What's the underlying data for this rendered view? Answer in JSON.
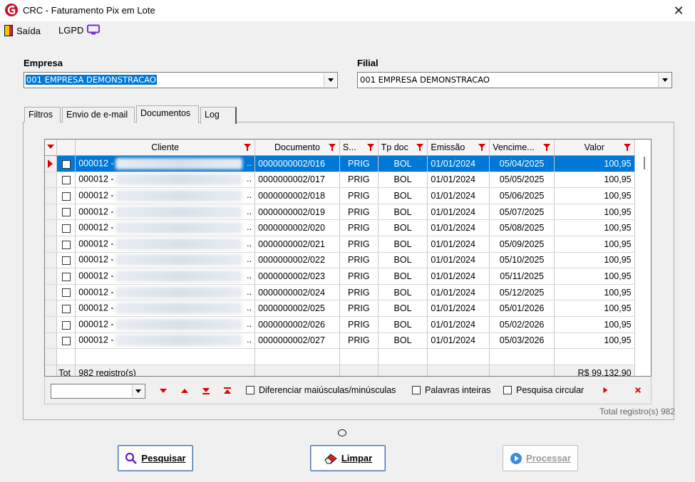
{
  "window": {
    "title": "CRC - Faturamento Pix em Lote"
  },
  "menu": {
    "saida": "Saída",
    "lgpd": "LGPD"
  },
  "empresa": {
    "label": "Empresa",
    "value": "001 EMPRESA DEMONSTRACAO"
  },
  "filial": {
    "label": "Filial",
    "value": "001 EMPRESA DEMONSTRACAO"
  },
  "tabs": [
    "Filtros",
    "Envio de e-mail",
    "Documentos",
    "Log"
  ],
  "grid": {
    "columns": [
      "Cliente",
      "Documento",
      "S...",
      "Tp doc",
      "Emissão",
      "Vencime...",
      "Valor"
    ],
    "rows": [
      {
        "cliente": "000012 -",
        "documento": "0000000002/016",
        "situacao": "PRIG",
        "tpdoc": "BOL",
        "emissao": "01/01/2024",
        "vencimento": "05/04/2025",
        "valor": "100,95"
      },
      {
        "cliente": "000012 -",
        "documento": "0000000002/017",
        "situacao": "PRIG",
        "tpdoc": "BOL",
        "emissao": "01/01/2024",
        "vencimento": "05/05/2025",
        "valor": "100,95"
      },
      {
        "cliente": "000012 -",
        "documento": "0000000002/018",
        "situacao": "PRIG",
        "tpdoc": "BOL",
        "emissao": "01/01/2024",
        "vencimento": "05/06/2025",
        "valor": "100,95"
      },
      {
        "cliente": "000012 -",
        "documento": "0000000002/019",
        "situacao": "PRIG",
        "tpdoc": "BOL",
        "emissao": "01/01/2024",
        "vencimento": "05/07/2025",
        "valor": "100,95"
      },
      {
        "cliente": "000012 -",
        "documento": "0000000002/020",
        "situacao": "PRIG",
        "tpdoc": "BOL",
        "emissao": "01/01/2024",
        "vencimento": "05/08/2025",
        "valor": "100,95"
      },
      {
        "cliente": "000012 -",
        "documento": "0000000002/021",
        "situacao": "PRIG",
        "tpdoc": "BOL",
        "emissao": "01/01/2024",
        "vencimento": "05/09/2025",
        "valor": "100,95"
      },
      {
        "cliente": "000012 -",
        "documento": "0000000002/022",
        "situacao": "PRIG",
        "tpdoc": "BOL",
        "emissao": "01/01/2024",
        "vencimento": "05/10/2025",
        "valor": "100,95"
      },
      {
        "cliente": "000012 -",
        "documento": "0000000002/023",
        "situacao": "PRIG",
        "tpdoc": "BOL",
        "emissao": "01/01/2024",
        "vencimento": "05/11/2025",
        "valor": "100,95"
      },
      {
        "cliente": "000012 -",
        "documento": "0000000002/024",
        "situacao": "PRIG",
        "tpdoc": "BOL",
        "emissao": "01/01/2024",
        "vencimento": "05/12/2025",
        "valor": "100,95"
      },
      {
        "cliente": "000012 -",
        "documento": "0000000002/025",
        "situacao": "PRIG",
        "tpdoc": "BOL",
        "emissao": "01/01/2024",
        "vencimento": "05/01/2026",
        "valor": "100,95"
      },
      {
        "cliente": "000012 -",
        "documento": "0000000002/026",
        "situacao": "PRIG",
        "tpdoc": "BOL",
        "emissao": "01/01/2024",
        "vencimento": "05/02/2026",
        "valor": "100,95"
      },
      {
        "cliente": "000012 -",
        "documento": "0000000002/027",
        "situacao": "PRIG",
        "tpdoc": "BOL",
        "emissao": "01/01/2024",
        "vencimento": "05/03/2026",
        "valor": "100,95"
      }
    ],
    "footer": {
      "tot_label": "Tot",
      "count": "982 registro(s)",
      "sum": "R$ 99.132,90"
    }
  },
  "search": {
    "opt_case": "Diferenciar maiúsculas/minúsculas",
    "opt_words": "Palavras inteiras",
    "opt_circular": "Pesquisa circular"
  },
  "status": {
    "total": "Total registro(s) 982"
  },
  "buttons": {
    "pesquisar": "Pesquisar",
    "limpar": "Limpar",
    "processar": "Processar"
  },
  "colors": {
    "selection": "#0078d7",
    "accent_red": "#e00000",
    "brand_purple": "#7b2fd1"
  }
}
